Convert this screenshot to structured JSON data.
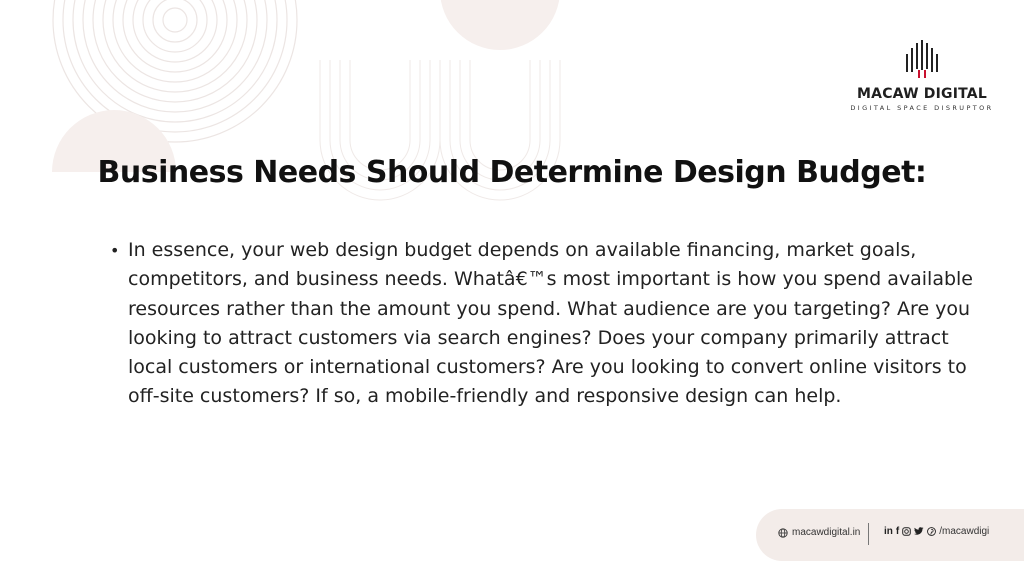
{
  "logo": {
    "name": "MACAW DIGITAL",
    "tagline": "DIGITAL SPACE DISRUPTOR"
  },
  "title": "Business Needs Should Determine Design Budget:",
  "bullets": [
    "In essence, your web design budget depends on available financing, market goals, competitors, and business needs. Whatâ€™s most important is how you spend available resources rather than the amount you spend. What audience are you targeting? Are you looking to attract customers via search engines? Does your company primarily attract local customers or international customers? Are you looking to convert online visitors to off-site customers? If so, a mobile-friendly and responsive design can help."
  ],
  "footer": {
    "website": "macawdigital.in",
    "social_handle": "/macawdigi",
    "icons": [
      "globe-icon",
      "linkedin-icon",
      "facebook-icon",
      "instagram-icon",
      "twitter-icon",
      "pinterest-icon"
    ]
  },
  "colors": {
    "accent": "#c8102e",
    "text": "#111111",
    "decor": "#f3ece9"
  }
}
